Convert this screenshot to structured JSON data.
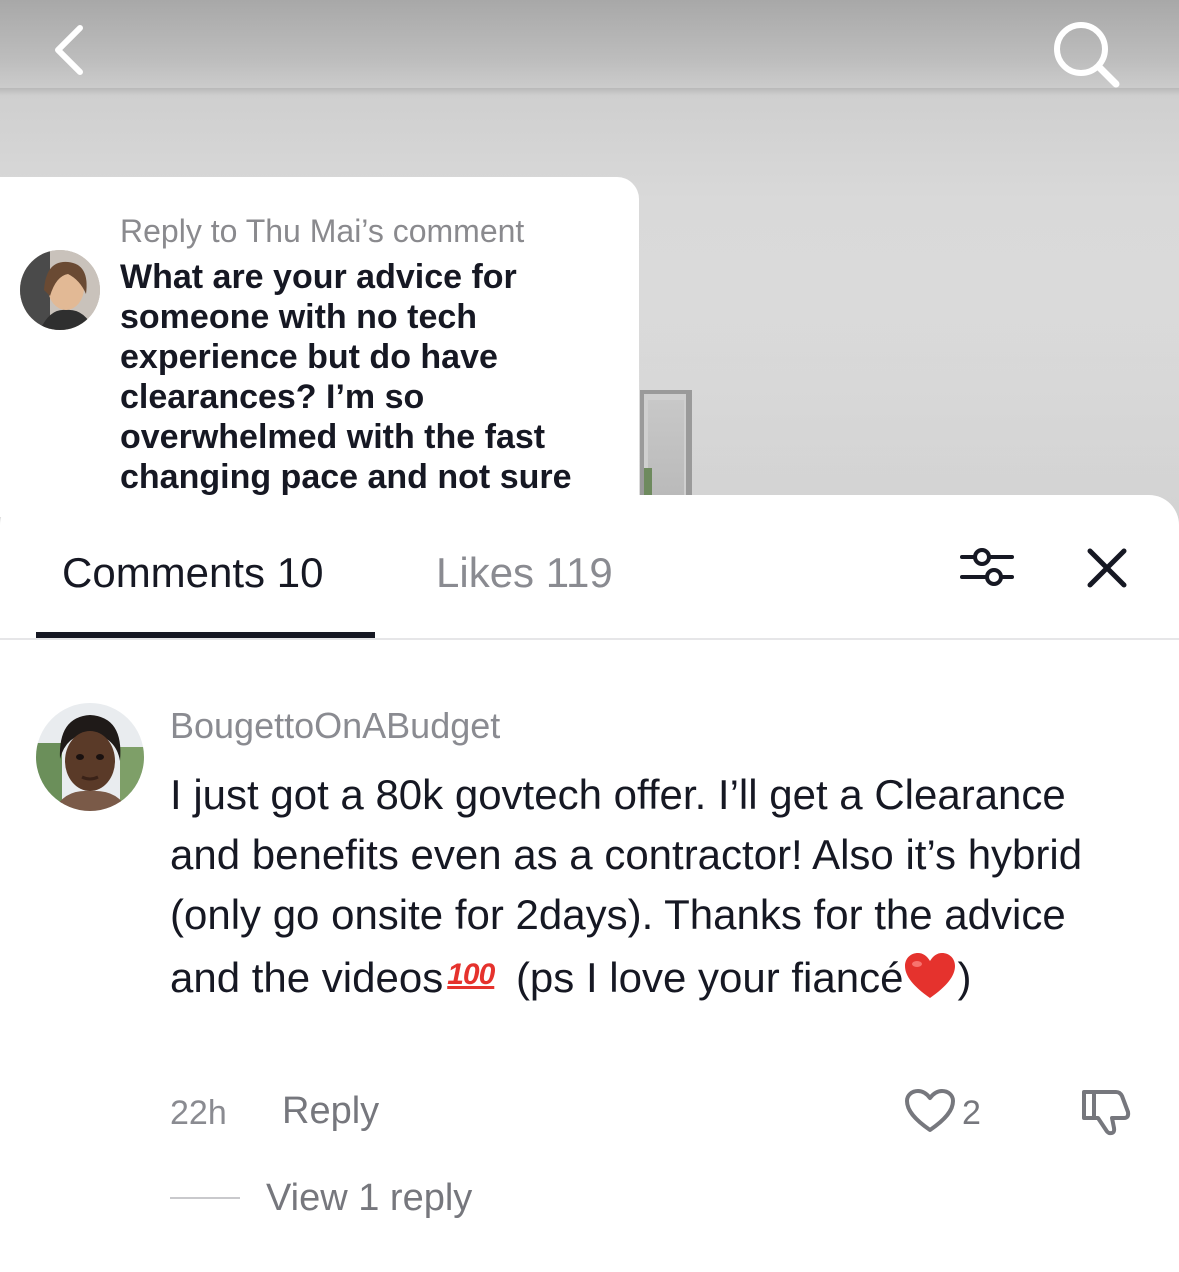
{
  "reply_card": {
    "header": "Reply to Thu Mai’s comment",
    "body": "What are your advice for someone with no tech experience but do have clearances? I’m so overwhelmed with the fast changing pace and not sure"
  },
  "tabs": {
    "comments_label": "Comments 10",
    "likes_label": "Likes 119"
  },
  "comment": {
    "username": "BougettoOnABudget",
    "text_part1": "I just got a 80k govtech offer. I’ll get a Clearance and benefits even as a contractor! Also it’s hybrid (only go onsite for 2days). Thanks for the advice and the videos",
    "hundred_emoji": "100",
    "text_part2": " (ps I love your fiancé",
    "text_part3": ")",
    "timestamp": "22h",
    "reply_label": "Reply",
    "like_count": "2",
    "view_replies": "View 1 reply"
  },
  "colors": {
    "text_primary": "#161823",
    "text_secondary": "#8a8b91",
    "heart_red": "#e5322d"
  }
}
